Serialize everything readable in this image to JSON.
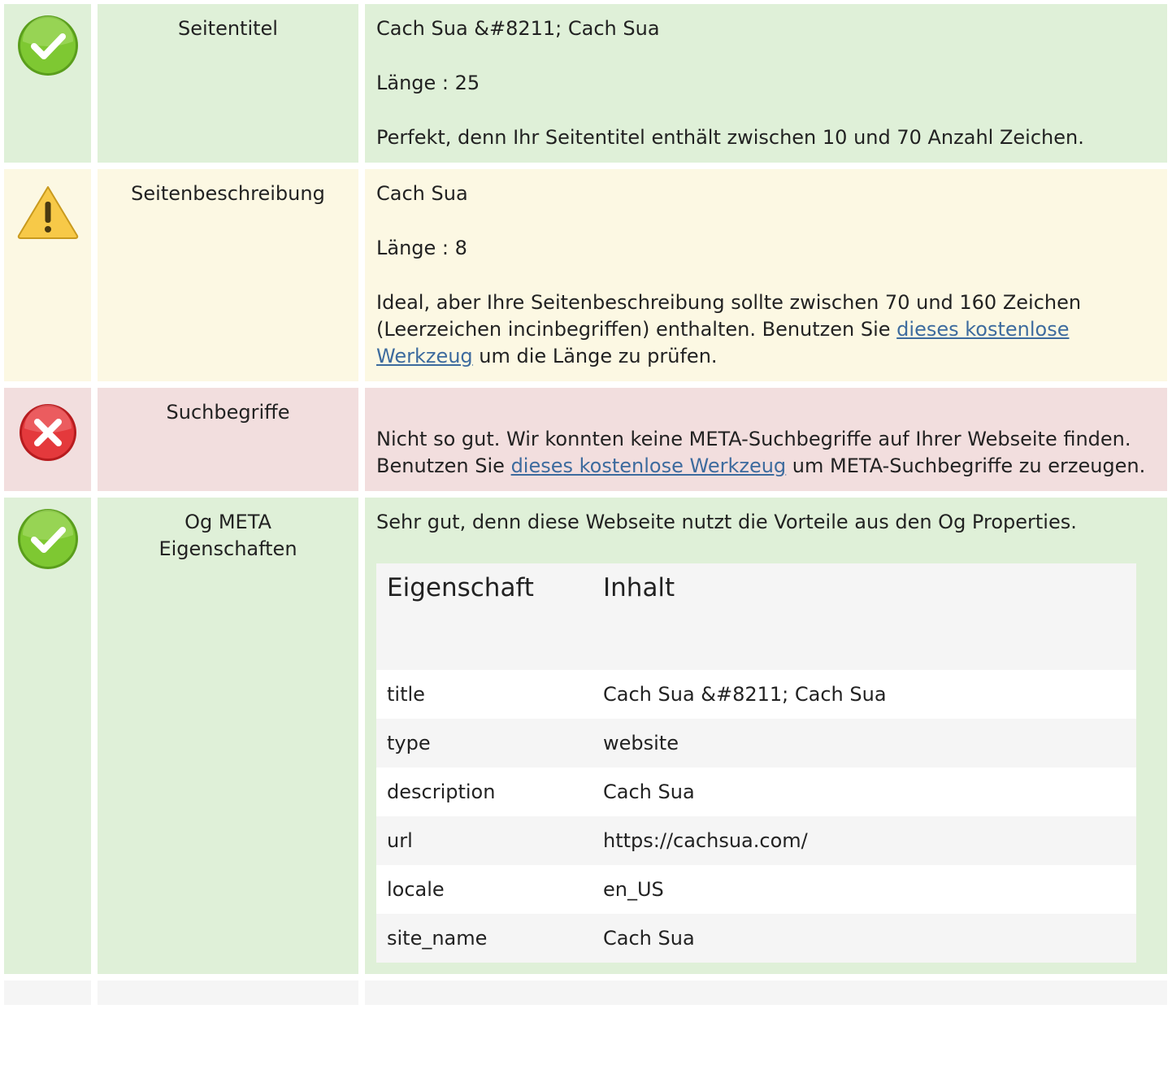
{
  "rows": [
    {
      "status": "good",
      "icon": "check-circle-icon",
      "label": "Seitentitel",
      "value": "Cach Sua &#8211; Cach Sua",
      "length": "Länge : 25",
      "message": "Perfekt, denn Ihr Seitentitel enthält zwischen 10 und 70 Anzahl Zeichen."
    },
    {
      "status": "warn",
      "icon": "warning-triangle-icon",
      "label": "Seitenbeschreibung",
      "value": "Cach Sua",
      "length": "Länge : 8",
      "message_before": "Ideal, aber Ihre Seitenbeschreibung sollte zwischen 70 und 160 Zeichen (Leerzeichen incinbegriffen) enthalten. Benutzen Sie ",
      "link": "dieses kostenlose Werkzeug",
      "message_after": " um die Länge zu prüfen."
    },
    {
      "status": "bad",
      "icon": "error-x-circle-icon",
      "label": "Suchbegriffe",
      "message_before": "Nicht so gut. Wir konnten keine META-Suchbegriffe auf Ihrer Webseite finden. Benutzen Sie ",
      "link": "dieses kostenlose Werkzeug",
      "message_after": " um META-Suchbegriffe zu erzeugen."
    },
    {
      "status": "good",
      "icon": "check-circle-icon",
      "label": "Og META Eigenschaften",
      "message": "Sehr gut, denn diese Webseite nutzt die Vorteile aus den Og Properties.",
      "table": {
        "headers": [
          "Eigenschaft",
          "Inhalt"
        ],
        "rows": [
          [
            "title",
            "Cach Sua &#8211; Cach Sua"
          ],
          [
            "type",
            "website"
          ],
          [
            "description",
            "Cach Sua"
          ],
          [
            "url",
            "https://cachsua.com/"
          ],
          [
            "locale",
            "en_US"
          ],
          [
            "site_name",
            "Cach Sua"
          ]
        ]
      }
    }
  ],
  "colors": {
    "good_bg": "#dff0d8",
    "warn_bg": "#fcf8e3",
    "bad_bg": "#f2dede",
    "link": "#3d6b9e",
    "check_green": "#7ec832",
    "warning_yellow": "#f7c948",
    "error_red": "#e4393c"
  }
}
